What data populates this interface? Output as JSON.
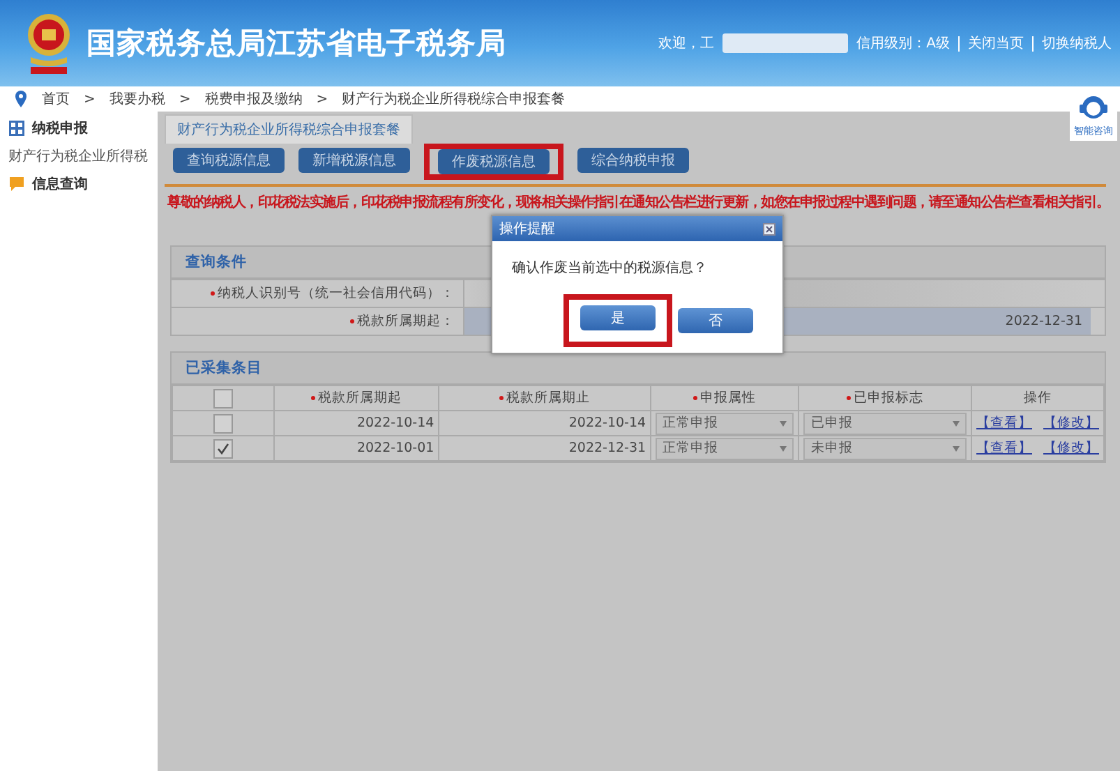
{
  "header": {
    "title": "国家税务总局江苏省电子税务局",
    "welcome": "欢迎，工",
    "credit": "信用级别：A级",
    "links": [
      "关闭当页",
      "切换纳税人"
    ]
  },
  "breadcrumb": {
    "separator": ">",
    "items": [
      "首页",
      "我要办税",
      "税费申报及缴纳",
      "财产行为税企业所得税综合申报套餐"
    ]
  },
  "assistant": {
    "label": "智能咨询"
  },
  "sidebar": {
    "items": [
      {
        "label": "纳税申报",
        "kind": "grid",
        "children": [
          {
            "label": "财产行为税企业所得税"
          }
        ]
      },
      {
        "label": "信息查询",
        "kind": "chat"
      }
    ]
  },
  "tabs": [
    {
      "label": "财产行为税企业所得税综合申报套餐",
      "selected": true
    }
  ],
  "toolbar": [
    {
      "label": "查询税源信息",
      "highlighted": false
    },
    {
      "label": "新增税源信息",
      "highlighted": false
    },
    {
      "label": "作废税源信息",
      "highlighted": true
    },
    {
      "label": "综合纳税申报",
      "highlighted": false
    }
  ],
  "notice": "尊敬的纳税人，印花税法实施后，印花税申报流程有所变化，现将相关操作指引在通知公告栏进行更新，如您在申报过程中遇到问题，请至通知公告栏查看相关指引。",
  "query": {
    "title": "查询条件",
    "rows": [
      {
        "label": "纳税人识别号（统一社会信用代码）："
      },
      {
        "label": "税款所属期起：",
        "value": "2022-12-31"
      }
    ]
  },
  "table": {
    "title": "已采集条目",
    "all_checked": false,
    "columns": [
      "税款所属期起",
      "税款所属期止",
      "申报属性",
      "已申报标志",
      "操作"
    ],
    "rows": [
      {
        "checked": false,
        "start": "2022-10-14",
        "end": "2022-10-14",
        "attribute": "正常申报",
        "status": "已申报",
        "actions": [
          "【查看】",
          "【修改】"
        ]
      },
      {
        "checked": true,
        "start": "2022-10-01",
        "end": "2022-12-31",
        "attribute": "正常申报",
        "status": "未申报",
        "actions": [
          "【查看】",
          "【修改】"
        ]
      }
    ]
  },
  "dialog": {
    "title": "操作提醒",
    "message": "确认作废当前选中的税源信息？",
    "buttons": [
      {
        "label": "是",
        "highlighted": true
      },
      {
        "label": "否",
        "highlighted": false
      }
    ]
  }
}
